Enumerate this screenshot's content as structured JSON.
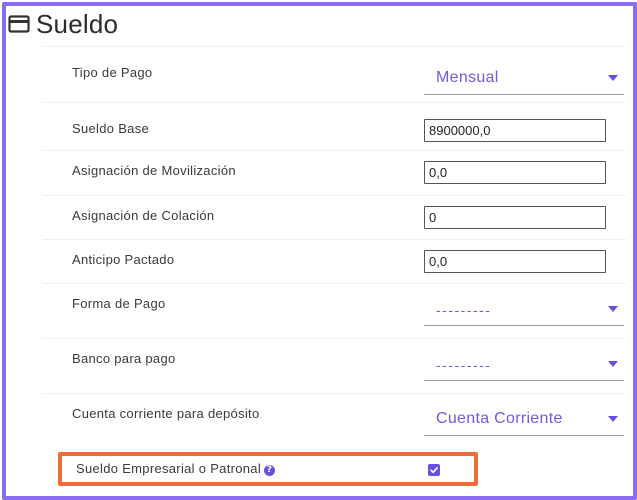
{
  "section": {
    "title": "Sueldo",
    "icon": "credit-card-icon"
  },
  "fields": {
    "tipo_pago": {
      "label": "Tipo de Pago",
      "value": "Mensual"
    },
    "sueldo_base": {
      "label": "Sueldo Base",
      "value": "8900000,0"
    },
    "asignacion_movilizacion": {
      "label": "Asignación de Movilización",
      "value": "0,0"
    },
    "asignacion_colacion": {
      "label": "Asignación de Colación",
      "value": "0"
    },
    "anticipo_pactado": {
      "label": "Anticipo Pactado",
      "value": "0,0"
    },
    "forma_pago": {
      "label": "Forma de Pago",
      "value": "---------"
    },
    "banco_pago": {
      "label": "Banco para pago",
      "value": "---------"
    },
    "cuenta_corriente": {
      "label": "Cuenta corriente para depósito",
      "value": "Cuenta Corriente"
    },
    "sueldo_empresarial": {
      "label": "Sueldo Empresarial o Patronal",
      "checked": true,
      "help_icon": "question-circle-icon"
    }
  },
  "colors": {
    "accent": "#6a4ee0",
    "frame": "#8a6cf0",
    "highlight": "#f26b3a"
  }
}
